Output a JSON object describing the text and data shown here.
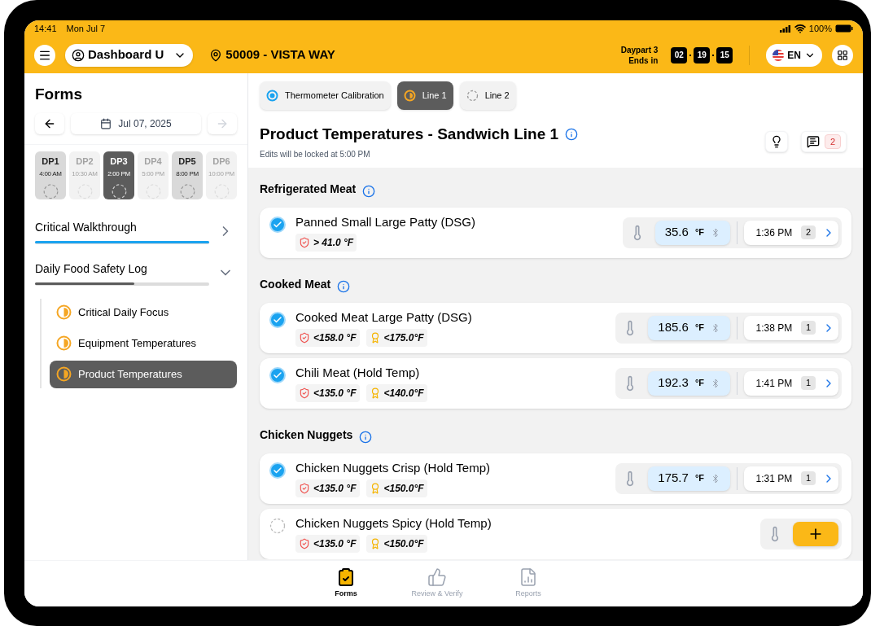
{
  "status_bar": {
    "time": "14:41",
    "date": "Mon Jul 7",
    "battery": "100%"
  },
  "header": {
    "user": "Dashboard U",
    "location": "50009 - VISTA WAY",
    "daypart": "Daypart 3",
    "ends_in": "Ends in",
    "countdown": [
      "02",
      "19",
      "15"
    ],
    "language": "EN"
  },
  "sidebar": {
    "title": "Forms",
    "date": "Jul 07, 2025",
    "dayparts": [
      {
        "name": "DP1",
        "time": "4:00 AM",
        "selected": false,
        "disabled": false
      },
      {
        "name": "DP2",
        "time": "10:30 AM",
        "selected": false,
        "disabled": true
      },
      {
        "name": "DP3",
        "time": "2:00 PM",
        "selected": true,
        "disabled": false
      },
      {
        "name": "DP4",
        "time": "5:00 PM",
        "selected": false,
        "disabled": true
      },
      {
        "name": "DP5",
        "time": "8:00 PM",
        "selected": false,
        "disabled": false
      },
      {
        "name": "DP6",
        "time": "10:00 PM",
        "selected": false,
        "disabled": true
      }
    ],
    "sections": [
      {
        "title": "Critical Walkthrough",
        "level": 1,
        "expanded": false
      },
      {
        "title": "Daily Food Safety Log",
        "level": 0.57,
        "expanded": true,
        "children": [
          {
            "label": "Critical Daily Focus",
            "kind": "partial",
            "selected": false
          },
          {
            "label": "Equipment Temperatures",
            "kind": "partial",
            "selected": false
          },
          {
            "label": "Product Temperatures",
            "kind": "partial",
            "selected": true
          }
        ]
      }
    ]
  },
  "tabs": [
    {
      "label": "Thermometer Calibration",
      "kind": "complete",
      "selected": false
    },
    {
      "label": "Line 1",
      "kind": "partial",
      "selected": true
    },
    {
      "label": "Line 2",
      "kind": "pending",
      "selected": false
    }
  ],
  "page": {
    "title": "Product Temperatures - Sandwich Line 1",
    "subtitle": "Edits will be locked at 5:00 PM",
    "comments": "2"
  },
  "groups": [
    {
      "title": "Refrigerated Meat",
      "items": [
        {
          "name": "Panned Small Large Patty (DSG)",
          "done": true,
          "limits": [
            {
              "kind": "safety",
              "text": "> 41.0 °F"
            }
          ],
          "reading": "35.6",
          "unit": "°F",
          "time": "1:36 PM",
          "count": "2"
        }
      ]
    },
    {
      "title": "Cooked Meat",
      "items": [
        {
          "name": "Cooked Meat Large Patty (DSG)",
          "done": true,
          "limits": [
            {
              "kind": "safety",
              "text": "<158.0 °F"
            },
            {
              "kind": "quality",
              "text": "<175.0°F"
            }
          ],
          "reading": "185.6",
          "unit": "°F",
          "time": "1:38 PM",
          "count": "1"
        },
        {
          "name": "Chili Meat (Hold Temp)",
          "done": true,
          "limits": [
            {
              "kind": "safety",
              "text": "<135.0 °F"
            },
            {
              "kind": "quality",
              "text": "<140.0°F"
            }
          ],
          "reading": "192.3",
          "unit": "°F",
          "time": "1:41 PM",
          "count": "1"
        }
      ]
    },
    {
      "title": "Chicken Nuggets",
      "items": [
        {
          "name": "Chicken Nuggets Crisp (Hold Temp)",
          "done": true,
          "limits": [
            {
              "kind": "safety",
              "text": "<135.0 °F"
            },
            {
              "kind": "quality",
              "text": "<150.0°F"
            }
          ],
          "reading": "175.7",
          "unit": "°F",
          "time": "1:31 PM",
          "count": "1"
        },
        {
          "name": "Chicken Nuggets Spicy (Hold Temp)",
          "done": false,
          "limits": [
            {
              "kind": "safety",
              "text": "<135.0 °F"
            },
            {
              "kind": "quality",
              "text": "<150.0°F"
            }
          ]
        }
      ]
    }
  ],
  "bottom_nav": [
    {
      "label": "Forms",
      "selected": true,
      "kind": "forms"
    },
    {
      "label": "Review & Verify",
      "selected": false,
      "kind": "review"
    },
    {
      "label": "Reports",
      "selected": false,
      "kind": "reports"
    }
  ]
}
